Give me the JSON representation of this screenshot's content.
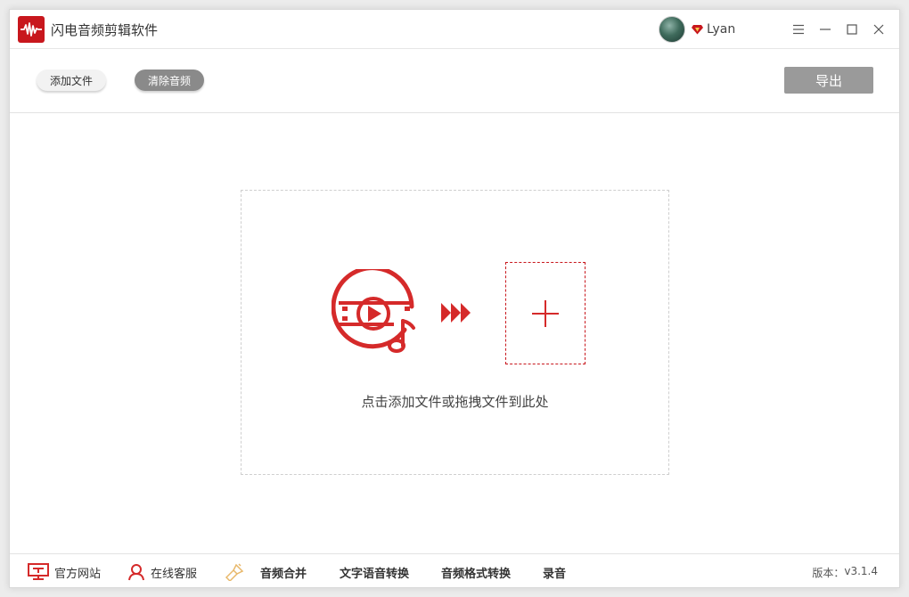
{
  "app": {
    "title": "闪电音频剪辑软件",
    "logo_icon": "audio-waveform-icon",
    "accent_color": "#c8171d"
  },
  "user": {
    "name": "Lyan",
    "badge_icon": "vip-diamond-icon"
  },
  "window_controls": {
    "menu_icon": "menu-icon",
    "minimize_icon": "minimize-icon",
    "maximize_icon": "maximize-icon",
    "close_icon": "close-icon"
  },
  "toolbar": {
    "add_file_label": "添加文件",
    "clear_audio_label": "清除音频",
    "export_label": "导出"
  },
  "drop_zone": {
    "hint": "点击添加文件或拖拽文件到此处",
    "media_icon": "video-music-icon",
    "arrow_icon": "triple-arrow-icon",
    "plus_icon": "plus-icon"
  },
  "footer": {
    "items": [
      {
        "label": "官方网站",
        "icon": "monitor-icon"
      },
      {
        "label": "在线客服",
        "icon": "user-service-icon"
      },
      {
        "label": "音频合并",
        "icon": "merge-icon"
      },
      {
        "label": "文字语音转换"
      },
      {
        "label": "音频格式转换"
      },
      {
        "label": "录音"
      }
    ],
    "version_label": "版本：",
    "version_value": "v3.1.4"
  }
}
